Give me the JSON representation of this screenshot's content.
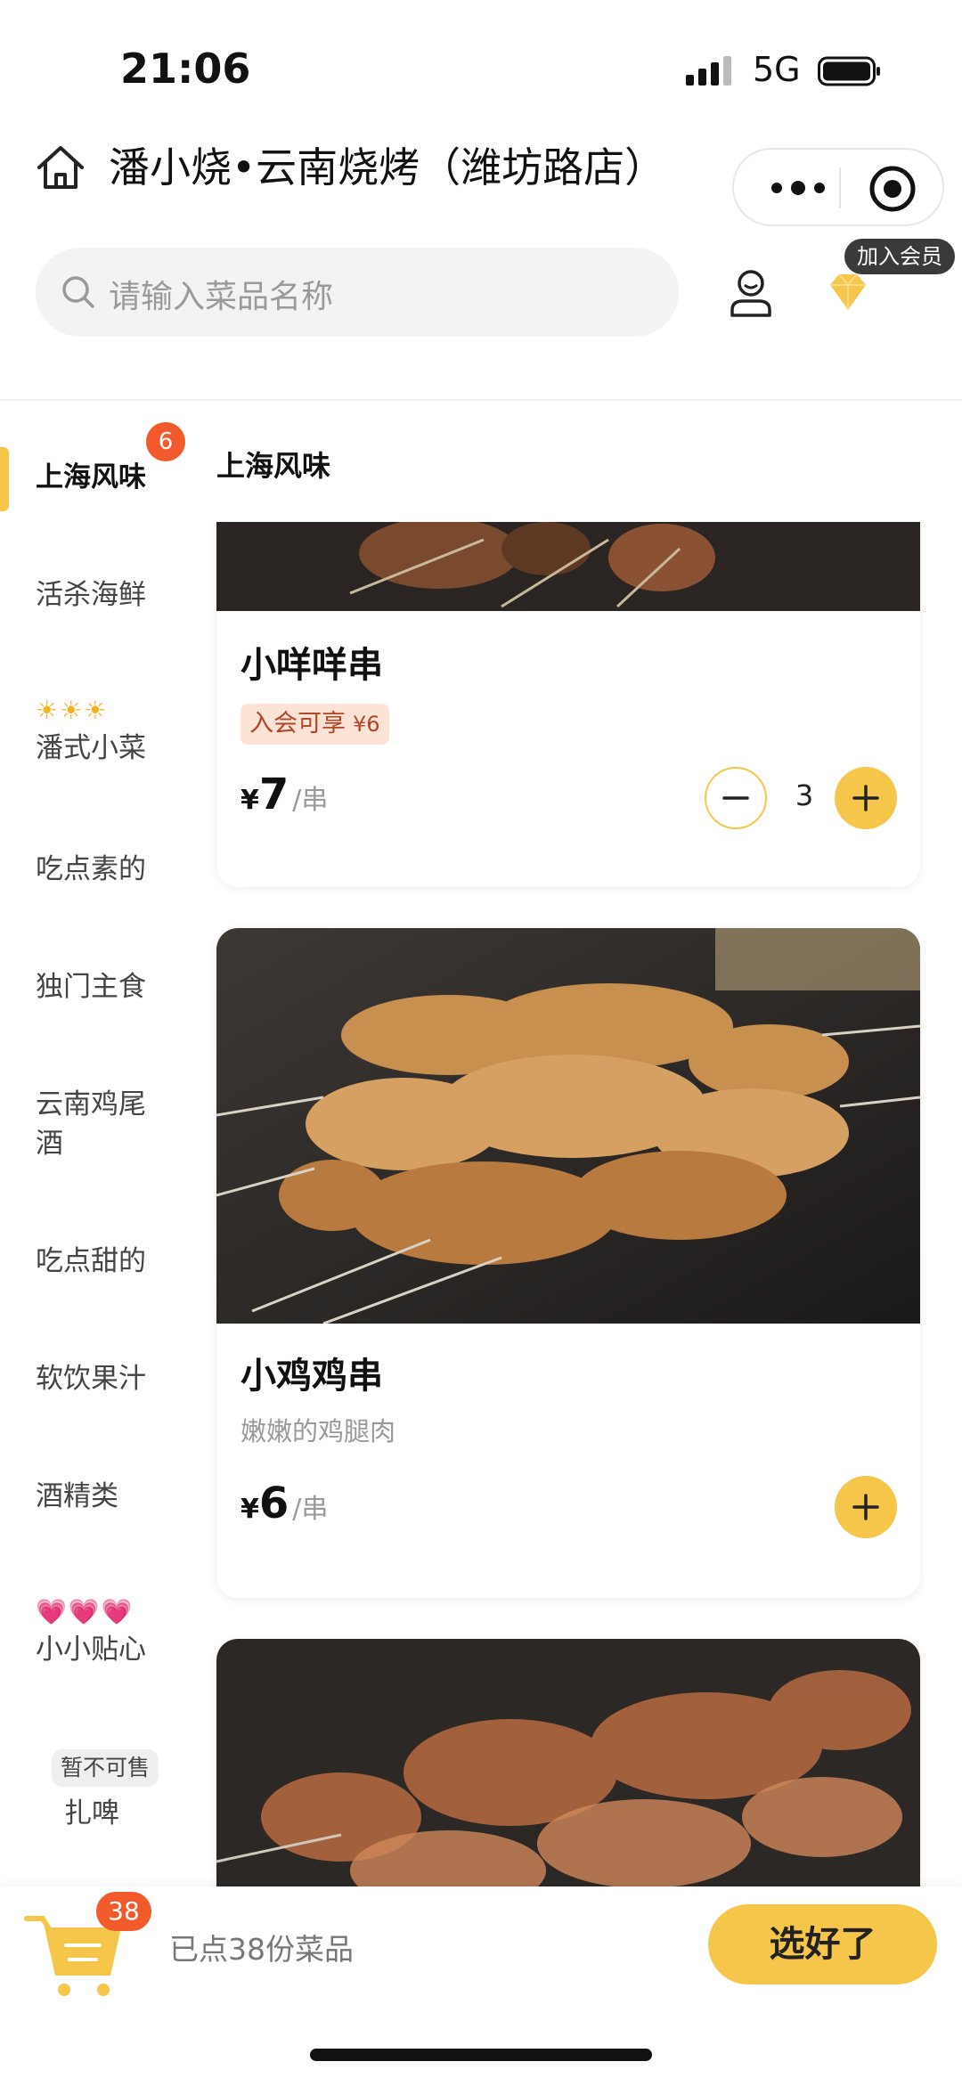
{
  "status_bar": {
    "time": "21:06",
    "network": "5G"
  },
  "header": {
    "shop_title": "潘小烧•云南烧烤（潍坊路店）",
    "search_placeholder": "请输入菜品名称",
    "member_tag": "加入会员"
  },
  "sidebar": {
    "active_badge": "6",
    "items": [
      {
        "label": "上海风味"
      },
      {
        "label": "活杀海鲜"
      },
      {
        "emoji": "☀☀☀",
        "label": "潘式小菜"
      },
      {
        "label": "吃点素的"
      },
      {
        "label": "独门主食"
      },
      {
        "label": "云南鸡尾酒"
      },
      {
        "label": "吃点甜的"
      },
      {
        "label": "软饮果汁"
      },
      {
        "label": "酒精类"
      },
      {
        "emoji": "💗💗💗",
        "label": "小小贴心"
      },
      {
        "label": "扎啤",
        "tag": "暂不可售"
      }
    ]
  },
  "content": {
    "section_title": "上海风味",
    "dishes": [
      {
        "name": "小咩咩串",
        "promo": "入会可享",
        "promo_price": "¥6",
        "currency": "¥",
        "price": "7",
        "unit": "/串",
        "quantity": "3"
      },
      {
        "name": "小鸡鸡串",
        "desc": "嫩嫩的鸡腿肉",
        "currency": "¥",
        "price": "6",
        "unit": "/串"
      }
    ]
  },
  "cart": {
    "count": "38",
    "summary": "已点38份菜品",
    "checkout_label": "选好了"
  },
  "colors": {
    "accent": "#f5c64a",
    "badge": "#f25a2c"
  }
}
